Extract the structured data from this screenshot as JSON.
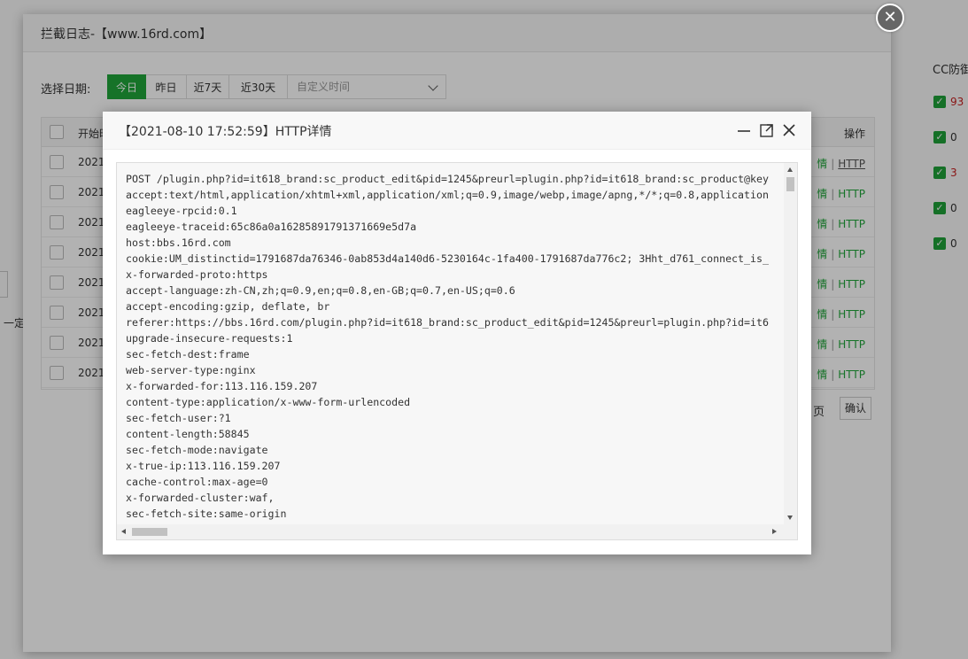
{
  "background": {
    "cc_header": "CC防御",
    "cc_values": [
      "93",
      "0",
      "3",
      "0",
      "0"
    ],
    "cc_value_colors": [
      "#cc2222",
      "#333333",
      "#cc2222",
      "#333333",
      "#333333"
    ],
    "left_text": "一定"
  },
  "outer_dialog": {
    "title": "拦截日志-【www.16rd.com】",
    "close_icon": "close-icon",
    "date_label": "选择日期:",
    "date_buttons": [
      "今日",
      "昨日",
      "近7天",
      "近30天"
    ],
    "date_custom_placeholder": "自定义时间",
    "table": {
      "header_start": "开始时",
      "header_op": "操作",
      "rows": [
        {
          "start": "2021",
          "op_detail": "情",
          "op_http": "HTTP"
        },
        {
          "start": "2021",
          "op_detail": "情",
          "op_http": "HTTP"
        },
        {
          "start": "2021",
          "op_detail": "情",
          "op_http": "HTTP"
        },
        {
          "start": "2021",
          "op_detail": "情",
          "op_http": "HTTP"
        },
        {
          "start": "2021",
          "op_detail": "情",
          "op_http": "HTTP"
        },
        {
          "start": "2021",
          "op_detail": "情",
          "op_http": "HTTP"
        },
        {
          "start": "2021",
          "op_detail": "情",
          "op_http": "HTTP"
        },
        {
          "start": "2021",
          "op_detail": "情",
          "op_http": "HTTP"
        }
      ]
    },
    "first_row_op_http": "HTTP",
    "pager_text": "页",
    "pager_confirm": "确认"
  },
  "inner_dialog": {
    "title": "【2021-08-10 17:52:59】HTTP详情",
    "lines": [
      "POST /plugin.php?id=it618_brand:sc_product_edit&pid=1245&preurl=plugin.php?id=it618_brand:sc_product@key",
      "accept:text/html,application/xhtml+xml,application/xml;q=0.9,image/webp,image/apng,*/*;q=0.8,application",
      "eagleeye-rpcid:0.1",
      "eagleeye-traceid:65c86a0a16285891791371669e5d7a",
      "host:bbs.16rd.com",
      "cookie:UM_distinctid=1791687da76346-0ab853d4a140d6-5230164c-1fa400-1791687da776c2; 3Hht_d761_connect_is_",
      "x-forwarded-proto:https",
      "accept-language:zh-CN,zh;q=0.9,en;q=0.8,en-GB;q=0.7,en-US;q=0.6",
      "accept-encoding:gzip, deflate, br",
      "referer:https://bbs.16rd.com/plugin.php?id=it618_brand:sc_product_edit&pid=1245&preurl=plugin.php?id=it6",
      "upgrade-insecure-requests:1",
      "sec-fetch-dest:frame",
      "web-server-type:nginx",
      "x-forwarded-for:113.116.159.207",
      "content-type:application/x-www-form-urlencoded",
      "sec-fetch-user:?1",
      "content-length:58845",
      "sec-fetch-mode:navigate",
      "x-true-ip:113.116.159.207",
      "cache-control:max-age=0",
      "x-forwarded-cluster:waf,",
      "sec-fetch-site:same-origin"
    ]
  },
  "colors": {
    "accent_green": "#20a53a"
  }
}
